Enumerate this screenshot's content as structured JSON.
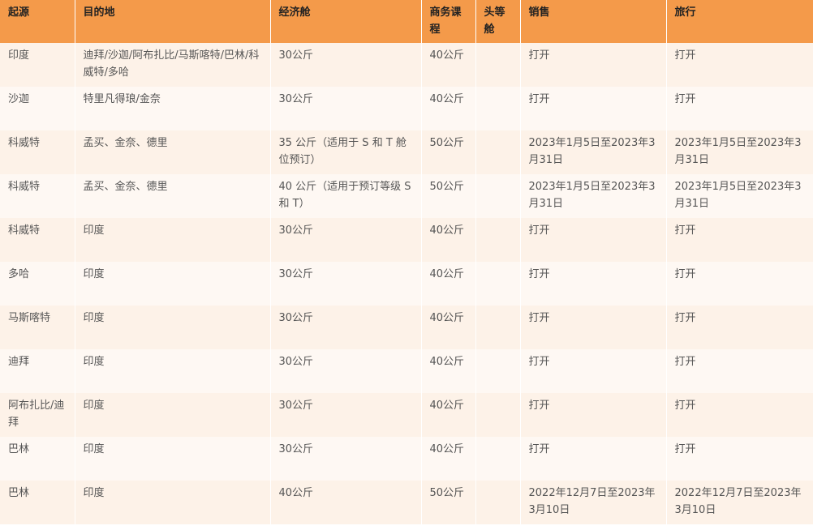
{
  "table": {
    "headers": [
      "起源",
      "目的地",
      "经济舱",
      "商务课程",
      "头等舱",
      "销售",
      "旅行"
    ],
    "rows": [
      [
        "印度",
        "迪拜/沙迦/阿布扎比/马斯喀特/巴林/科威特/多哈",
        "30公斤",
        "40公斤",
        "",
        "打开",
        "打开"
      ],
      [
        "沙迦",
        "特里凡得琅/金奈",
        "30公斤",
        "40公斤",
        "",
        "打开",
        "打开"
      ],
      [
        "科威特",
        "孟买、金奈、德里",
        "35 公斤（适用于 S 和 T 舱位预订）",
        "50公斤",
        "",
        "2023年1月5日至2023年3月31日",
        "2023年1月5日至2023年3月31日"
      ],
      [
        "科威特",
        "孟买、金奈、德里",
        "40 公斤（适用于预订等级 S 和 T）",
        "50公斤",
        "",
        "2023年1月5日至2023年3月31日",
        "2023年1月5日至2023年3月31日"
      ],
      [
        "科威特",
        "印度",
        "30公斤",
        "40公斤",
        "",
        "打开",
        "打开"
      ],
      [
        "多哈",
        "印度",
        "30公斤",
        "40公斤",
        "",
        "打开",
        "打开"
      ],
      [
        "马斯喀特",
        "印度",
        "30公斤",
        "40公斤",
        "",
        "打开",
        "打开"
      ],
      [
        "迪拜",
        "印度",
        "30公斤",
        "40公斤",
        "",
        "打开",
        "打开"
      ],
      [
        "阿布扎比/迪拜",
        "印度",
        "30公斤",
        "40公斤",
        "",
        "打开",
        "打开"
      ],
      [
        "巴林",
        "印度",
        "30公斤",
        "40公斤",
        "",
        "打开",
        "打开"
      ],
      [
        "巴林",
        "印度",
        "40公斤",
        "50公斤",
        "",
        "2022年12月7日至2023年3月10日",
        "2022年12月7日至2023年3月10日"
      ]
    ]
  }
}
